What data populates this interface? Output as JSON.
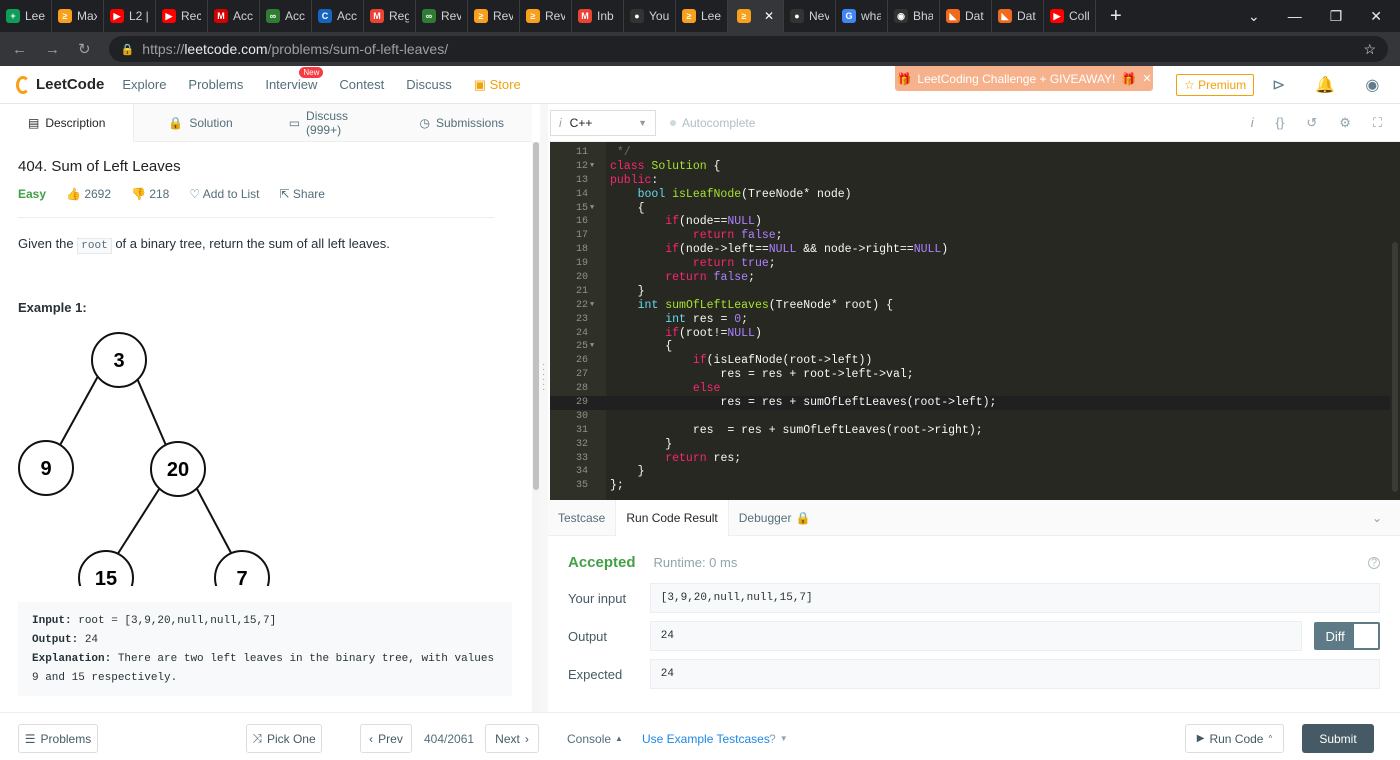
{
  "browser": {
    "tabs": [
      {
        "label": "Leet",
        "color": "#0f9d58",
        "glyph": "+"
      },
      {
        "label": "Max",
        "color": "#f89f1b",
        "glyph": "≥"
      },
      {
        "label": "L2 |",
        "color": "#ff0000",
        "glyph": "▶"
      },
      {
        "label": "Rec",
        "color": "#ff0000",
        "glyph": "▶"
      },
      {
        "label": "Acc",
        "color": "#d50000",
        "glyph": "M"
      },
      {
        "label": "Acc",
        "color": "#2e7d32",
        "glyph": "∞"
      },
      {
        "label": "Acc",
        "color": "#1565c0",
        "glyph": "C"
      },
      {
        "label": "Reg",
        "color": "#ea4335",
        "glyph": "M"
      },
      {
        "label": "Rev",
        "color": "#2e7d32",
        "glyph": "∞"
      },
      {
        "label": "Rev",
        "color": "#f89f1b",
        "glyph": "≥"
      },
      {
        "label": "Rev",
        "color": "#f89f1b",
        "glyph": "≥"
      },
      {
        "label": "Inb",
        "color": "#ea4335",
        "glyph": "M"
      },
      {
        "label": "You",
        "color": "#333333",
        "glyph": "●"
      },
      {
        "label": "Lee",
        "color": "#f89f1b",
        "glyph": "≥"
      }
    ],
    "tabs_after": [
      {
        "label": "Nev",
        "color": "#333333",
        "glyph": "●"
      },
      {
        "label": "wha",
        "color": "#4285f4",
        "glyph": "G"
      },
      {
        "label": "Bha",
        "color": "#333333",
        "glyph": "◉"
      },
      {
        "label": "Dat",
        "color": "#f06a1b",
        "glyph": "◣"
      },
      {
        "label": "Dat",
        "color": "#f06a1b",
        "glyph": "◣"
      },
      {
        "label": "Coll",
        "color": "#ff0000",
        "glyph": "▶"
      }
    ],
    "url_prefix": "https://",
    "url_host": "leetcode.com",
    "url_path": "/problems/sum-of-left-leaves/"
  },
  "nav": {
    "logo": "LeetCode",
    "items": [
      "Explore",
      "Problems",
      "Interview",
      "Contest",
      "Discuss"
    ],
    "new_badge": "New",
    "store": "Store",
    "promo": "LeetCoding Challenge + GIVEAWAY!",
    "premium": "Premium"
  },
  "left_tabs": [
    "Description",
    "Solution",
    "Discuss (999+)",
    "Submissions"
  ],
  "problem": {
    "title": "404. Sum of Left Leaves",
    "difficulty": "Easy",
    "likes": "2692",
    "dislikes": "218",
    "add_to_list": "Add to List",
    "share": "Share",
    "statement_pre": "Given the",
    "statement_code": "root",
    "statement_post": "of a binary tree, return the sum of all left leaves.",
    "example_heading": "Example 1:",
    "tree_nodes": [
      "3",
      "9",
      "20",
      "15",
      "7"
    ],
    "example_input_label": "Input:",
    "example_input": "root = [3,9,20,null,null,15,7]",
    "example_output_label": "Output:",
    "example_output": "24",
    "example_expl_label": "Explanation:",
    "example_expl": "There are two left leaves in the binary tree, with values 9 and 15 respectively."
  },
  "editor": {
    "language": "C++",
    "autocomplete": "Autocomplete"
  },
  "result": {
    "tabs": [
      "Testcase",
      "Run Code Result",
      "Debugger"
    ],
    "status": "Accepted",
    "runtime": "Runtime: 0 ms",
    "your_input_label": "Your input",
    "your_input": "[3,9,20,null,null,15,7]",
    "output_label": "Output",
    "output": "24",
    "expected_label": "Expected",
    "expected": "24",
    "diff": "Diff"
  },
  "bottom": {
    "problems": "Problems",
    "pick_one": "Pick One",
    "prev": "Prev",
    "counter": "404/2061",
    "next": "Next",
    "console": "Console",
    "use_example": "Use Example Testcases",
    "run_code": "Run Code",
    "submit": "Submit"
  }
}
